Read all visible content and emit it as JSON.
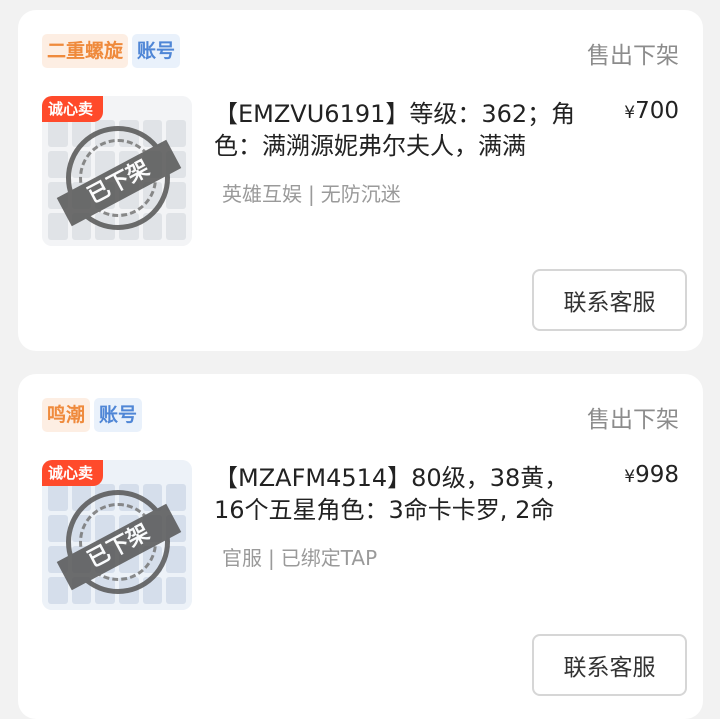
{
  "listings": [
    {
      "game_tag": "二重螺旋",
      "type_tag": "账号",
      "status": "售出下架",
      "badge": "诚心卖",
      "stamp": "已下架",
      "title": "【EMZVU6191】等级：362；角色：满溯源妮弗尔夫人，满满",
      "price_currency": "¥",
      "price_value": "700",
      "meta_server": "英雄互娱",
      "meta_sep": "|",
      "meta_info": "无防沉迷",
      "button": "联系客服"
    },
    {
      "game_tag": "鸣潮",
      "type_tag": "账号",
      "status": "售出下架",
      "badge": "诚心卖",
      "stamp": "已下架",
      "title": "【MZAFM4514】80级，38黄，16个五星角色：3命卡卡罗, 2命",
      "price_currency": "¥",
      "price_value": "998",
      "meta_server": "官服",
      "meta_sep": "|",
      "meta_info": "已绑定TAP",
      "button": "联系客服"
    }
  ]
}
